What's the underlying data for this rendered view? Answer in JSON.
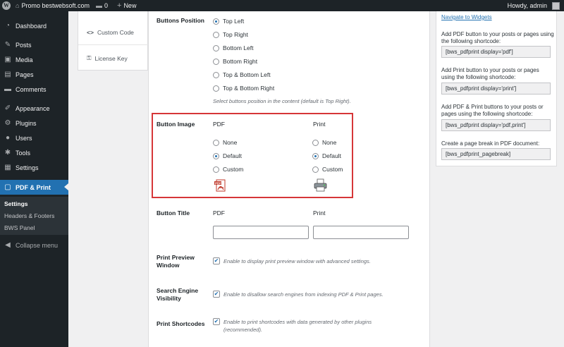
{
  "admin_bar": {
    "site_name": "Promo bestwebsoft.com",
    "comments_count": "0",
    "new_label": "New",
    "greeting": "Howdy, admin"
  },
  "menu": {
    "items": [
      {
        "label": "Dashboard",
        "icon": "dashboard-icon",
        "glyph": "◔"
      },
      {
        "label": "Posts",
        "icon": "pin-icon",
        "glyph": "✎"
      },
      {
        "label": "Media",
        "icon": "media-icon",
        "glyph": "▣"
      },
      {
        "label": "Pages",
        "icon": "pages-icon",
        "glyph": "▤"
      },
      {
        "label": "Comments",
        "icon": "comment-icon",
        "glyph": "▬"
      },
      {
        "label": "Appearance",
        "icon": "brush-icon",
        "glyph": "✐"
      },
      {
        "label": "Plugins",
        "icon": "plug-icon",
        "glyph": "⚙"
      },
      {
        "label": "Users",
        "icon": "user-icon",
        "glyph": "●"
      },
      {
        "label": "Tools",
        "icon": "wrench-icon",
        "glyph": "✱"
      },
      {
        "label": "Settings",
        "icon": "sliders-icon",
        "glyph": "▦"
      },
      {
        "label": "PDF & Print",
        "icon": "pdf-print-icon",
        "glyph": "▢"
      }
    ],
    "submenu": [
      "Settings",
      "Headers & Footers",
      "BWS Panel"
    ],
    "collapse": "Collapse menu"
  },
  "tabs": {
    "custom_code": "Custom Code",
    "license_key": "License Key"
  },
  "buttons_position": {
    "label": "Buttons Position",
    "options": [
      "Top Left",
      "Top Right",
      "Bottom Left",
      "Bottom Right",
      "Top & Bottom Left",
      "Top & Bottom Right"
    ],
    "selected": "Top Left",
    "description": "Select buttons position in the content (default is Top Right)."
  },
  "button_image": {
    "label": "Button Image",
    "pdf_heading": "PDF",
    "print_heading": "Print",
    "options": [
      "None",
      "Default",
      "Custom"
    ],
    "pdf_selected": "Default",
    "print_selected": "Default"
  },
  "button_title": {
    "label": "Button Title",
    "pdf_heading": "PDF",
    "print_heading": "Print",
    "pdf_value": "",
    "print_value": ""
  },
  "print_preview": {
    "label": "Print Preview Window",
    "checked": true,
    "description": "Enable to display print preview window with advanced settings."
  },
  "search_engine": {
    "label": "Search Engine Visibility",
    "checked": true,
    "description": "Enable to disallow search engines from indexing PDF & Print pages."
  },
  "print_shortcodes": {
    "label": "Print Shortcodes",
    "checked": true,
    "description": "Enable to print shortcodes with data generated by other plugins (recommended)."
  },
  "sidebar_box": {
    "widgets_link": "Navigate to Widgets",
    "pdf_text": "Add PDF button to your posts or pages using the following shortcode:",
    "pdf_code": "[bws_pdfprint display='pdf']",
    "print_text": "Add Print button to your posts or pages using the following shortcode:",
    "print_code": "[bws_pdfprint display='print']",
    "both_text": "Add PDF & Print buttons to your posts or pages using the following shortcode:",
    "both_code": "[bws_pdfprint display='pdf,print']",
    "break_text": "Create a page break in PDF document:",
    "break_code": "[bws_pdfprint_pagebreak]"
  },
  "colors": {
    "accent": "#2271b1",
    "highlight": "#d63638",
    "admin_dark": "#1d2327"
  }
}
